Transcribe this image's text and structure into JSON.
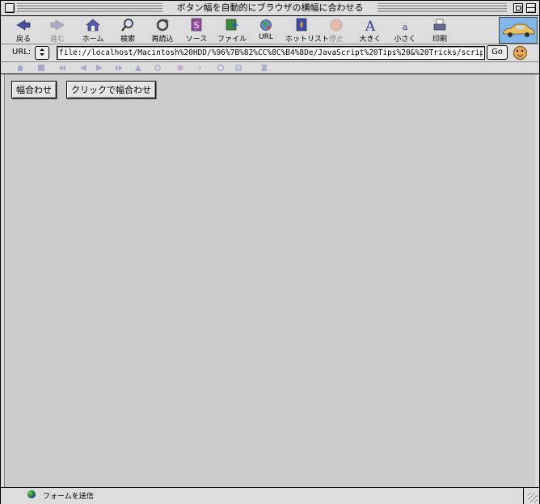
{
  "window": {
    "title": "ボタン幅を自動的にブラウザの横幅に合わせる"
  },
  "toolbar": {
    "buttons": [
      {
        "label": "戻る",
        "icon": "back-icon"
      },
      {
        "label": "進む",
        "icon": "forward-icon"
      },
      {
        "label": "ホーム",
        "icon": "home-icon"
      },
      {
        "label": "検索",
        "icon": "search-icon"
      },
      {
        "label": "再読込",
        "icon": "reload-icon"
      },
      {
        "label": "ソース",
        "icon": "source-icon"
      },
      {
        "label": "ファイル",
        "icon": "file-icon"
      },
      {
        "label": "URL",
        "icon": "url-icon"
      },
      {
        "label": "ホットリスト",
        "icon": "hotlist-icon"
      },
      {
        "label": "停止",
        "icon": "stop-icon"
      },
      {
        "label": "大きく",
        "icon": "larger-text-icon"
      },
      {
        "label": "小さく",
        "icon": "smaller-text-icon"
      },
      {
        "label": "印刷",
        "icon": "print-icon"
      }
    ]
  },
  "urlbar": {
    "label": "URL:",
    "value": "file://localhost/Macintosh%20HDD/%96%7B%82%CC%8C%B4%8De/JavaScript%20Tips%20&%20Tricks/scrip",
    "go_label": "Go"
  },
  "page": {
    "button1_label": "幅合わせ",
    "button2_label": "クリックで幅合わせ"
  },
  "status": {
    "text": "フォームを送信"
  },
  "colors": {
    "window_bg": "#dddddd",
    "content_bg": "#cccccc",
    "logo_sky": "#7fb8e8",
    "car": "#e8c060"
  }
}
